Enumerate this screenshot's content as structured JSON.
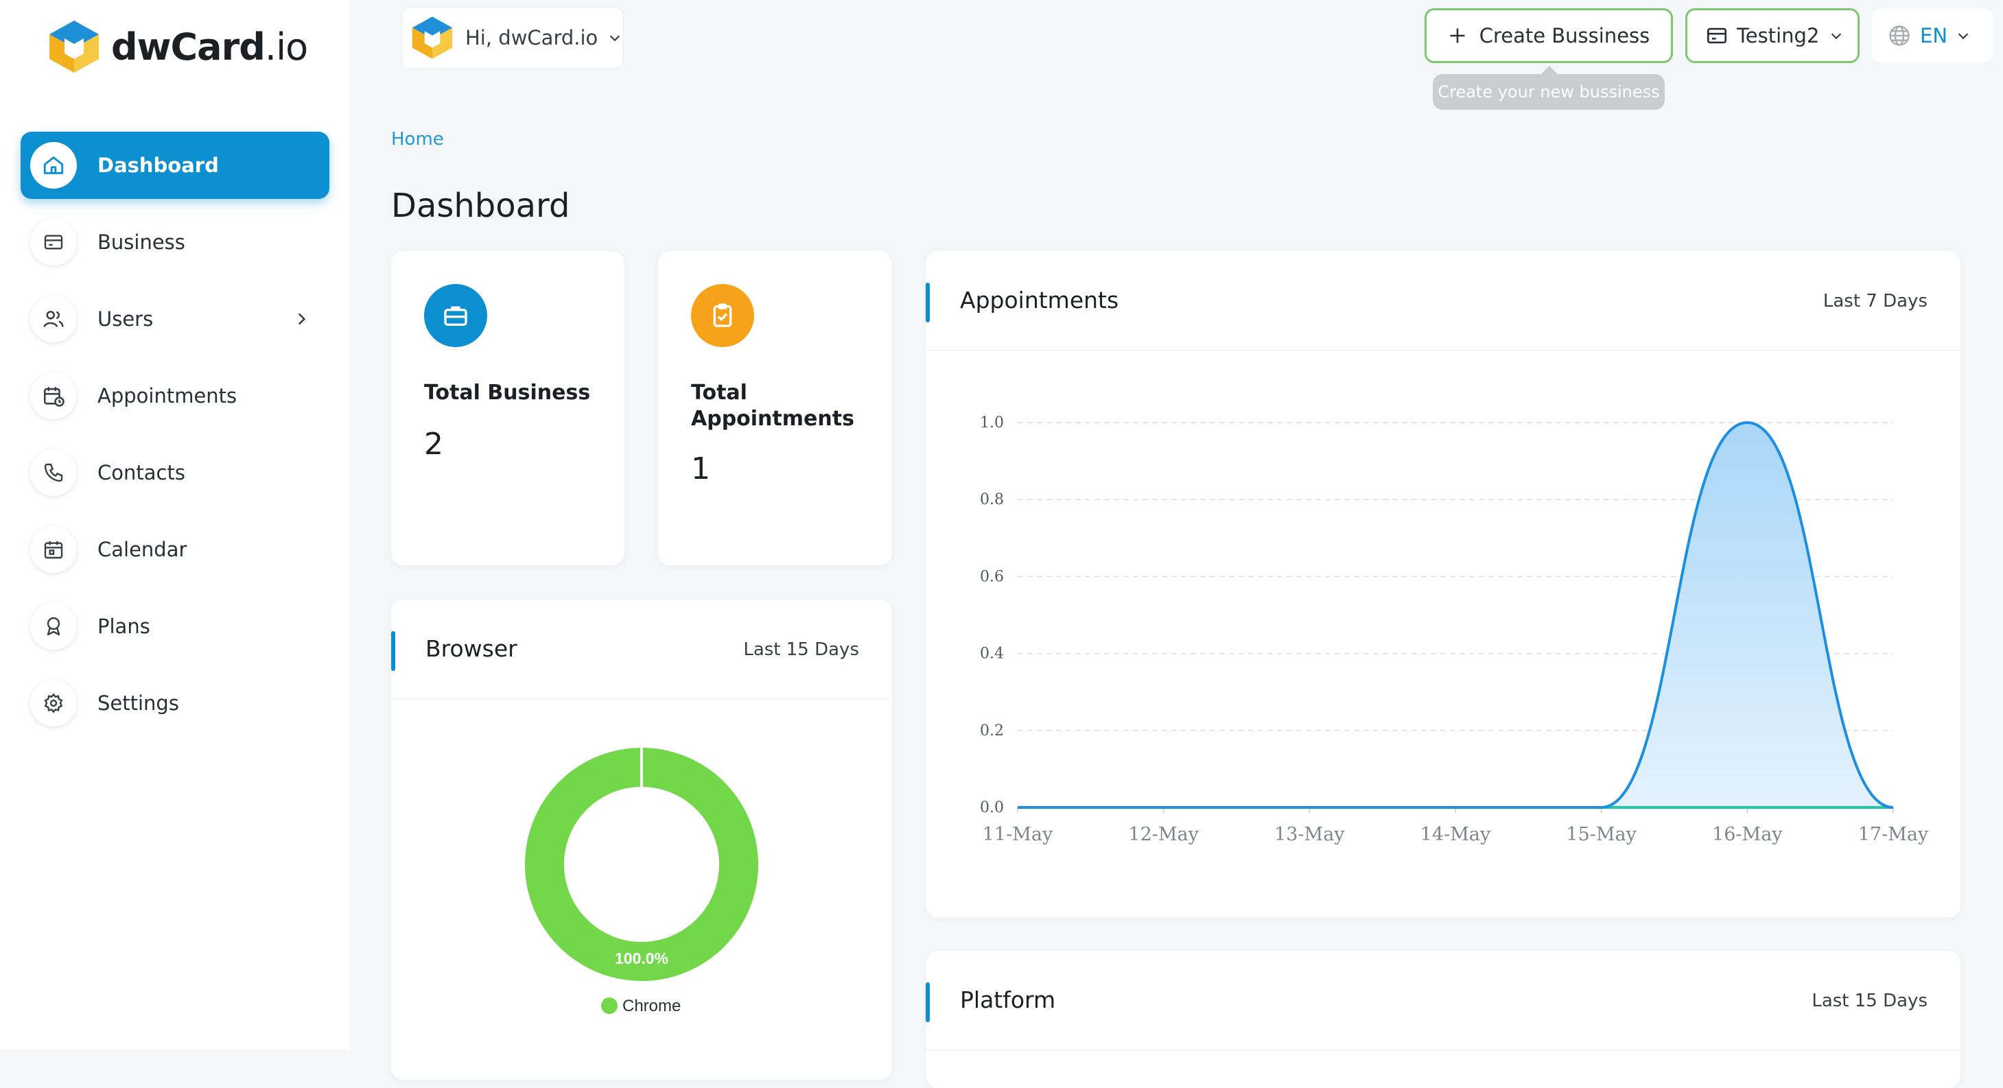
{
  "brand": {
    "name": "dwCard",
    "tld": ".io"
  },
  "sidebar": {
    "items": [
      {
        "label": "Dashboard",
        "icon": "home-icon",
        "active": true
      },
      {
        "label": "Business",
        "icon": "card-icon"
      },
      {
        "label": "Users",
        "icon": "users-icon",
        "has_submenu": true
      },
      {
        "label": "Appointments",
        "icon": "calendar-clock-icon"
      },
      {
        "label": "Contacts",
        "icon": "phone-icon"
      },
      {
        "label": "Calendar",
        "icon": "calendar-icon"
      },
      {
        "label": "Plans",
        "icon": "award-icon"
      },
      {
        "label": "Settings",
        "icon": "gear-icon"
      }
    ]
  },
  "topbar": {
    "greeting": "Hi, dwCard.io",
    "create_label": "Create Bussiness",
    "create_tooltip": "Create your new bussiness",
    "business_label": "Testing2",
    "language": "EN"
  },
  "breadcrumb": "Home",
  "page_title": "Dashboard",
  "stats": {
    "total_business": {
      "label": "Total Business",
      "value": "2"
    },
    "total_appointments": {
      "label": "Total Appointments",
      "value": "1"
    }
  },
  "appointments_card": {
    "title": "Appointments",
    "range": "Last 7 Days"
  },
  "browser_card": {
    "title": "Browser",
    "range": "Last 15 Days"
  },
  "platform_card": {
    "title": "Platform",
    "range": "Last 15 Days"
  },
  "colors": {
    "primary": "#0b8fd0",
    "accent_green": "#7cc96f",
    "orange": "#f7a21b",
    "chart_line": "#1d8fe0",
    "chart_fill": "#a9d6f8",
    "baseline": "#22c9a0",
    "donut": "#72d84a"
  },
  "chart_data": [
    {
      "type": "area",
      "x": [
        "11-May",
        "12-May",
        "13-May",
        "14-May",
        "15-May",
        "16-May",
        "17-May"
      ],
      "series": [
        {
          "values": [
            0,
            0,
            0,
            0,
            0,
            1,
            0
          ]
        }
      ],
      "ylim": [
        0,
        1
      ],
      "yticks": [
        "0.0",
        "0.2",
        "0.4",
        "0.6",
        "0.8",
        "1.0"
      ],
      "grid": true
    },
    {
      "type": "pie",
      "labels": [
        "Chrome"
      ],
      "values": [
        100
      ],
      "data_labels": [
        "100.0%"
      ],
      "legend": "bottom"
    }
  ]
}
